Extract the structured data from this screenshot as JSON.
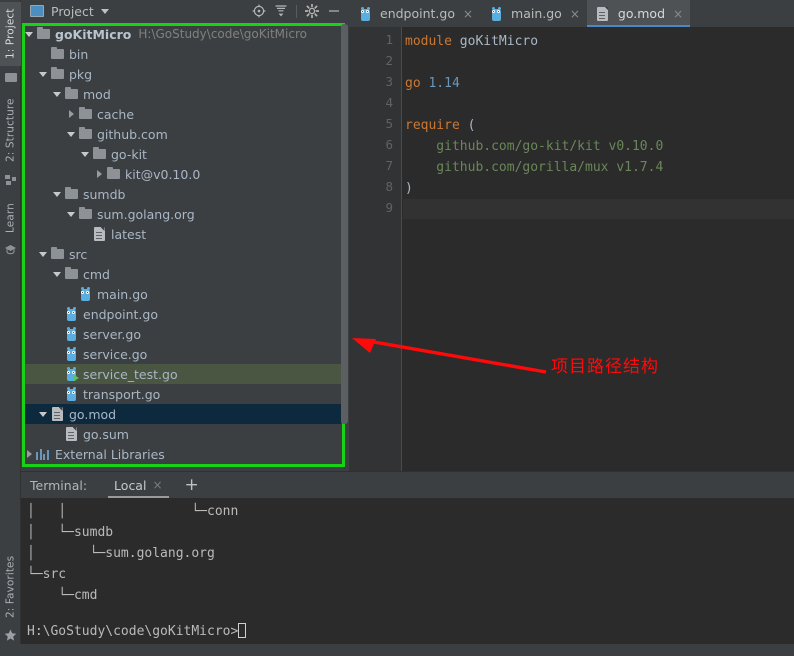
{
  "rail": {
    "left_items": [
      {
        "label": "1: Project",
        "icon": "project-icon",
        "active": true
      },
      {
        "label": "2: Structure",
        "icon": "structure-icon",
        "active": false
      },
      {
        "label": "Learn",
        "icon": "learn-icon",
        "active": false
      }
    ],
    "bottom_items": [
      {
        "label": "2: Favorites",
        "icon": "star-icon",
        "active": false
      }
    ]
  },
  "project_panel": {
    "title": "Project",
    "title_icon": "project-window-icon",
    "dropdown_icon": "chevron-down-icon",
    "tools": [
      {
        "name": "locate-icon",
        "glyph": "⊕"
      },
      {
        "name": "collapse-all-icon",
        "glyph": "≃"
      },
      {
        "name": "gear-icon",
        "glyph": "⚙"
      },
      {
        "name": "minimize-icon",
        "glyph": "—"
      }
    ],
    "tree": [
      {
        "label": "goKitMicro",
        "path": "H:\\GoStudy\\code\\goKitMicro",
        "depth": 0,
        "icon": "folder-icon",
        "twisty": "down",
        "bold": true,
        "state": "none"
      },
      {
        "label": "bin",
        "path": "",
        "depth": 1,
        "icon": "folder-icon",
        "twisty": "none",
        "bold": false,
        "state": "none"
      },
      {
        "label": "pkg",
        "path": "",
        "depth": 1,
        "icon": "folder-icon",
        "twisty": "down",
        "bold": false,
        "state": "none"
      },
      {
        "label": "mod",
        "path": "",
        "depth": 2,
        "icon": "folder-icon",
        "twisty": "down",
        "bold": false,
        "state": "none"
      },
      {
        "label": "cache",
        "path": "",
        "depth": 3,
        "icon": "folder-icon",
        "twisty": "right",
        "bold": false,
        "state": "none"
      },
      {
        "label": "github.com",
        "path": "",
        "depth": 3,
        "icon": "folder-icon",
        "twisty": "down",
        "bold": false,
        "state": "none"
      },
      {
        "label": "go-kit",
        "path": "",
        "depth": 4,
        "icon": "folder-icon",
        "twisty": "down",
        "bold": false,
        "state": "none"
      },
      {
        "label": "kit@v0.10.0",
        "path": "",
        "depth": 5,
        "icon": "folder-icon",
        "twisty": "right",
        "bold": false,
        "state": "none"
      },
      {
        "label": "sumdb",
        "path": "",
        "depth": 2,
        "icon": "folder-icon",
        "twisty": "down",
        "bold": false,
        "state": "none"
      },
      {
        "label": "sum.golang.org",
        "path": "",
        "depth": 3,
        "icon": "folder-icon",
        "twisty": "down",
        "bold": false,
        "state": "none"
      },
      {
        "label": "latest",
        "path": "",
        "depth": 4,
        "icon": "file-doc-icon",
        "twisty": "none",
        "bold": false,
        "state": "none"
      },
      {
        "label": "src",
        "path": "",
        "depth": 1,
        "icon": "folder-icon",
        "twisty": "down",
        "bold": false,
        "state": "none"
      },
      {
        "label": "cmd",
        "path": "",
        "depth": 2,
        "icon": "folder-icon",
        "twisty": "down",
        "bold": false,
        "state": "none"
      },
      {
        "label": "main.go",
        "path": "",
        "depth": 3,
        "icon": "go-file-icon",
        "twisty": "none",
        "bold": false,
        "state": "none"
      },
      {
        "label": "endpoint.go",
        "path": "",
        "depth": 2,
        "icon": "go-file-icon",
        "twisty": "none",
        "bold": false,
        "state": "none"
      },
      {
        "label": "server.go",
        "path": "",
        "depth": 2,
        "icon": "go-file-icon",
        "twisty": "none",
        "bold": false,
        "state": "none"
      },
      {
        "label": "service.go",
        "path": "",
        "depth": 2,
        "icon": "go-file-icon",
        "twisty": "none",
        "bold": false,
        "state": "none"
      },
      {
        "label": "service_test.go",
        "path": "",
        "depth": 2,
        "icon": "go-test-file-icon",
        "twisty": "none",
        "bold": false,
        "state": "green"
      },
      {
        "label": "transport.go",
        "path": "",
        "depth": 2,
        "icon": "go-file-icon",
        "twisty": "none",
        "bold": false,
        "state": "none"
      },
      {
        "label": "go.mod",
        "path": "",
        "depth": 1,
        "icon": "file-doc-icon",
        "twisty": "down",
        "bold": false,
        "state": "blue"
      },
      {
        "label": "go.sum",
        "path": "",
        "depth": 2,
        "icon": "file-doc-icon",
        "twisty": "none",
        "bold": false,
        "state": "none"
      },
      {
        "label": "External Libraries",
        "path": "",
        "depth": 0,
        "icon": "libraries-icon",
        "twisty": "right",
        "bold": false,
        "state": "none"
      }
    ]
  },
  "editor": {
    "tabs": [
      {
        "label": "endpoint.go",
        "icon": "go-file-icon",
        "active": false,
        "close": "×"
      },
      {
        "label": "main.go",
        "icon": "go-file-icon",
        "active": false,
        "close": "×"
      },
      {
        "label": "go.mod",
        "icon": "file-doc-icon",
        "active": true,
        "close": "×"
      }
    ],
    "line_numbers": [
      "1",
      "2",
      "3",
      "4",
      "5",
      "6",
      "7",
      "8",
      "9"
    ],
    "current_line": 9,
    "code": [
      [
        {
          "t": "module ",
          "c": "kw"
        },
        {
          "t": "goKitMicro",
          "c": "ident"
        }
      ],
      [],
      [
        {
          "t": "go ",
          "c": "kw"
        },
        {
          "t": "1.14",
          "c": "num"
        }
      ],
      [],
      [
        {
          "t": "require ",
          "c": "kw"
        },
        {
          "t": "(",
          "c": "punc"
        }
      ],
      [
        {
          "t": "    github.com/go-kit/kit v0.10.0",
          "c": "str"
        }
      ],
      [
        {
          "t": "    github.com/gorilla/mux v1.7.4",
          "c": "str"
        }
      ],
      [
        {
          "t": ")",
          "c": "punc"
        }
      ],
      []
    ]
  },
  "annotation": {
    "text": "项目路径结构",
    "color": "#ff0a0a",
    "highlight_box_color": "#18d218"
  },
  "terminal": {
    "label": "Terminal:",
    "tab": "Local",
    "tab_close": "×",
    "add_tab": "+",
    "lines": [
      "│   │                └─conn",
      "│   └─sumdb",
      "│       └─sum.golang.org",
      "└─src",
      "    └─cmd"
    ],
    "prompt": "H:\\GoStudy\\code\\goKitMicro>"
  }
}
